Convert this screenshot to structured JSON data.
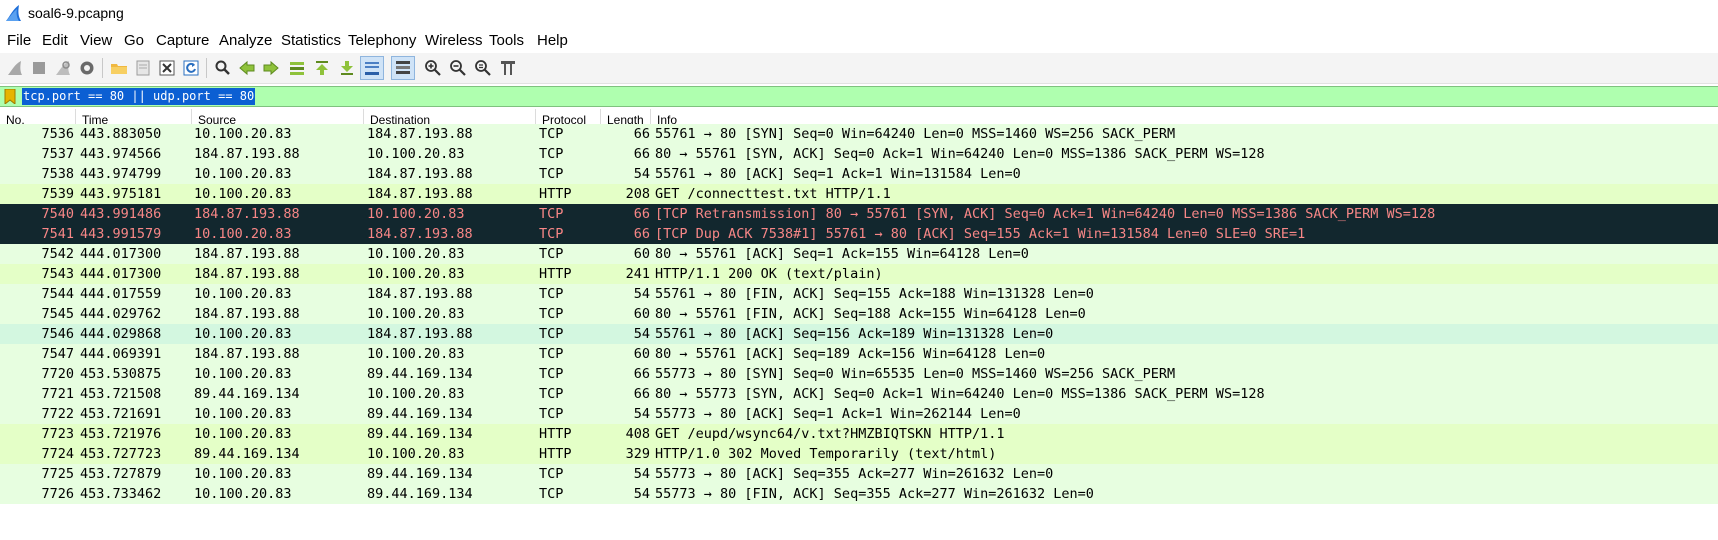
{
  "window": {
    "title": "soal6-9.pcapng"
  },
  "menu": [
    "File",
    "Edit",
    "View",
    "Go",
    "Capture",
    "Analyze",
    "Statistics",
    "Telephony",
    "Wireless",
    "Tools",
    "Help"
  ],
  "toolbar": {
    "buttons": [
      "start-capture-icon",
      "stop-capture-icon",
      "restart-capture-icon",
      "capture-options-icon",
      "open-file-icon",
      "save-file-icon",
      "close-file-icon",
      "reload-file-icon",
      "find-packet-icon",
      "go-back-icon",
      "go-forward-icon",
      "go-to-packet-icon",
      "go-first-icon",
      "go-last-icon",
      "autoscroll-icon",
      "colorize-icon",
      "zoom-in-icon",
      "zoom-out-icon",
      "zoom-normal-icon",
      "resize-columns-icon"
    ]
  },
  "filter": {
    "value": "tcp.port == 80 || udp.port == 80"
  },
  "columns": [
    "No.",
    "Time",
    "Source",
    "Destination",
    "Protocol",
    "Length",
    "Info"
  ],
  "colors": {
    "filter_bg": "#afffaf",
    "http_row": "#e4ffc7",
    "tcp_row": "#e7fee0",
    "bad_row_bg": "#12272e",
    "bad_row_fg": "#f78787"
  },
  "packets": [
    {
      "no": "7536",
      "time": "443.883050",
      "src": "10.100.20.83",
      "dst": "184.87.193.88",
      "proto": "TCP",
      "len": "66",
      "info": "55761 → 80 [SYN] Seq=0 Win=64240 Len=0 MSS=1460 WS=256 SACK_PERM",
      "style": "tcp"
    },
    {
      "no": "7537",
      "time": "443.974566",
      "src": "184.87.193.88",
      "dst": "10.100.20.83",
      "proto": "TCP",
      "len": "66",
      "info": "80 → 55761 [SYN, ACK] Seq=0 Ack=1 Win=64240 Len=0 MSS=1386 SACK_PERM WS=128",
      "style": "tcp"
    },
    {
      "no": "7538",
      "time": "443.974799",
      "src": "10.100.20.83",
      "dst": "184.87.193.88",
      "proto": "TCP",
      "len": "54",
      "info": "55761 → 80 [ACK] Seq=1 Ack=1 Win=131584 Len=0",
      "style": "tcp"
    },
    {
      "no": "7539",
      "time": "443.975181",
      "src": "10.100.20.83",
      "dst": "184.87.193.88",
      "proto": "HTTP",
      "len": "208",
      "info": "GET /connecttest.txt HTTP/1.1",
      "style": "http"
    },
    {
      "no": "7540",
      "time": "443.991486",
      "src": "184.87.193.88",
      "dst": "10.100.20.83",
      "proto": "TCP",
      "len": "66",
      "info": "[TCP Retransmission] 80 → 55761 [SYN, ACK] Seq=0 Ack=1 Win=64240 Len=0 MSS=1386 SACK_PERM WS=128",
      "style": "bad"
    },
    {
      "no": "7541",
      "time": "443.991579",
      "src": "10.100.20.83",
      "dst": "184.87.193.88",
      "proto": "TCP",
      "len": "66",
      "info": "[TCP Dup ACK 7538#1] 55761 → 80 [ACK] Seq=155 Ack=1 Win=131584 Len=0 SLE=0 SRE=1",
      "style": "bad"
    },
    {
      "no": "7542",
      "time": "444.017300",
      "src": "184.87.193.88",
      "dst": "10.100.20.83",
      "proto": "TCP",
      "len": "60",
      "info": "80 → 55761 [ACK] Seq=1 Ack=155 Win=64128 Len=0",
      "style": "tcp"
    },
    {
      "no": "7543",
      "time": "444.017300",
      "src": "184.87.193.88",
      "dst": "10.100.20.83",
      "proto": "HTTP",
      "len": "241",
      "info": "HTTP/1.1 200 OK  (text/plain)",
      "style": "http"
    },
    {
      "no": "7544",
      "time": "444.017559",
      "src": "10.100.20.83",
      "dst": "184.87.193.88",
      "proto": "TCP",
      "len": "54",
      "info": "55761 → 80 [FIN, ACK] Seq=155 Ack=188 Win=131328 Len=0",
      "style": "tcp"
    },
    {
      "no": "7545",
      "time": "444.029762",
      "src": "184.87.193.88",
      "dst": "10.100.20.83",
      "proto": "TCP",
      "len": "60",
      "info": "80 → 55761 [FIN, ACK] Seq=188 Ack=155 Win=64128 Len=0",
      "style": "tcp"
    },
    {
      "no": "7546",
      "time": "444.029868",
      "src": "10.100.20.83",
      "dst": "184.87.193.88",
      "proto": "TCP",
      "len": "54",
      "info": "55761 → 80 [ACK] Seq=156 Ack=189 Win=131328 Len=0",
      "style": "alt"
    },
    {
      "no": "7547",
      "time": "444.069391",
      "src": "184.87.193.88",
      "dst": "10.100.20.83",
      "proto": "TCP",
      "len": "60",
      "info": "80 → 55761 [ACK] Seq=189 Ack=156 Win=64128 Len=0",
      "style": "tcp"
    },
    {
      "no": "7720",
      "time": "453.530875",
      "src": "10.100.20.83",
      "dst": "89.44.169.134",
      "proto": "TCP",
      "len": "66",
      "info": "55773 → 80 [SYN] Seq=0 Win=65535 Len=0 MSS=1460 WS=256 SACK_PERM",
      "style": "tcp"
    },
    {
      "no": "7721",
      "time": "453.721508",
      "src": "89.44.169.134",
      "dst": "10.100.20.83",
      "proto": "TCP",
      "len": "66",
      "info": "80 → 55773 [SYN, ACK] Seq=0 Ack=1 Win=64240 Len=0 MSS=1386 SACK_PERM WS=128",
      "style": "tcp"
    },
    {
      "no": "7722",
      "time": "453.721691",
      "src": "10.100.20.83",
      "dst": "89.44.169.134",
      "proto": "TCP",
      "len": "54",
      "info": "55773 → 80 [ACK] Seq=1 Ack=1 Win=262144 Len=0",
      "style": "tcp"
    },
    {
      "no": "7723",
      "time": "453.721976",
      "src": "10.100.20.83",
      "dst": "89.44.169.134",
      "proto": "HTTP",
      "len": "408",
      "info": "GET /eupd/wsync64/v.txt?HMZBIQTSKN HTTP/1.1",
      "style": "http"
    },
    {
      "no": "7724",
      "time": "453.727723",
      "src": "89.44.169.134",
      "dst": "10.100.20.83",
      "proto": "HTTP",
      "len": "329",
      "info": "HTTP/1.0 302 Moved Temporarily  (text/html)",
      "style": "http"
    },
    {
      "no": "7725",
      "time": "453.727879",
      "src": "10.100.20.83",
      "dst": "89.44.169.134",
      "proto": "TCP",
      "len": "54",
      "info": "55773 → 80 [ACK] Seq=355 Ack=277 Win=261632 Len=0",
      "style": "tcp"
    },
    {
      "no": "7726",
      "time": "453.733462",
      "src": "10.100.20.83",
      "dst": "89.44.169.134",
      "proto": "TCP",
      "len": "54",
      "info": "55773 → 80 [FIN, ACK] Seq=355 Ack=277 Win=261632 Len=0",
      "style": "tcp"
    }
  ]
}
